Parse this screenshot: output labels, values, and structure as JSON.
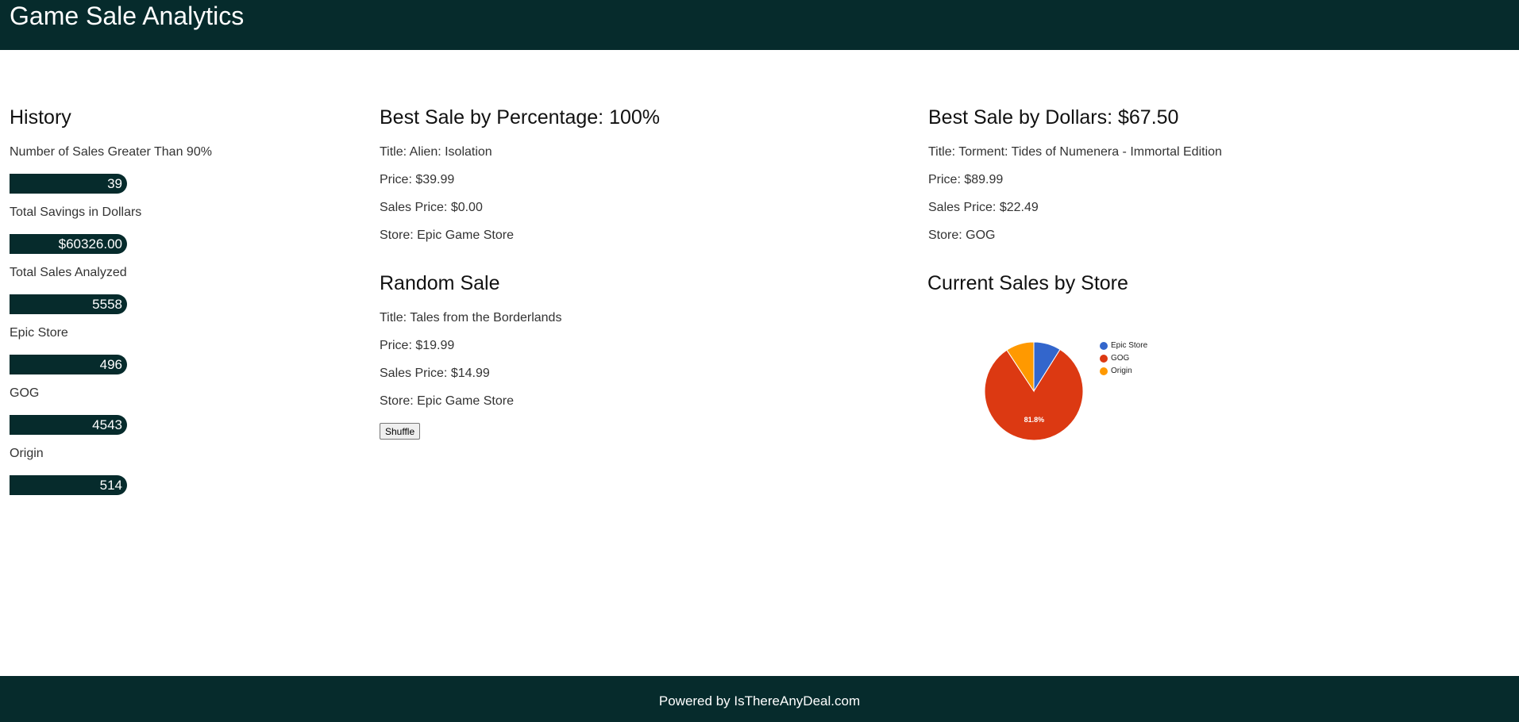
{
  "header": {
    "title": "Game Sale Analytics"
  },
  "history": {
    "title": "History",
    "stats": [
      {
        "label": "Number of Sales Greater Than 90%",
        "value": "39"
      },
      {
        "label": "Total Savings in Dollars",
        "value": "$60326.00"
      },
      {
        "label": "Total Sales Analyzed",
        "value": "5558"
      },
      {
        "label": "Epic Store",
        "value": "496"
      },
      {
        "label": "GOG",
        "value": "4543"
      },
      {
        "label": "Origin",
        "value": "514"
      }
    ]
  },
  "best_percentage": {
    "title": "Best Sale by Percentage: 100%",
    "lines": [
      "Title: Alien: Isolation",
      "Price: $39.99",
      "Sales Price: $0.00",
      "Store: Epic Game Store"
    ]
  },
  "random_sale": {
    "title": "Random Sale",
    "lines": [
      "Title: Tales from the Borderlands",
      "Price: $19.99",
      "Sales Price: $14.99",
      "Store: Epic Game Store"
    ],
    "shuffle_label": "Shuffle"
  },
  "best_dollars": {
    "title": "Best Sale by Dollars: $67.50",
    "lines": [
      "Title: Torment: Tides of Numenera - Immortal Edition",
      "Price: $89.99",
      "Sales Price: $22.49",
      "Store: GOG"
    ]
  },
  "store_chart": {
    "title": "Current Sales by Store"
  },
  "chart_data": {
    "type": "pie",
    "title": "",
    "categories": [
      "Epic Store",
      "GOG",
      "Origin"
    ],
    "values": [
      496,
      4543,
      514
    ],
    "colors": [
      "#3366cc",
      "#dc3912",
      "#ff9900"
    ],
    "slice_labels": [
      "",
      "81.8%",
      ""
    ],
    "legend_position": "right"
  },
  "footer": {
    "text": "Powered by IsThereAnyDeal.com"
  }
}
